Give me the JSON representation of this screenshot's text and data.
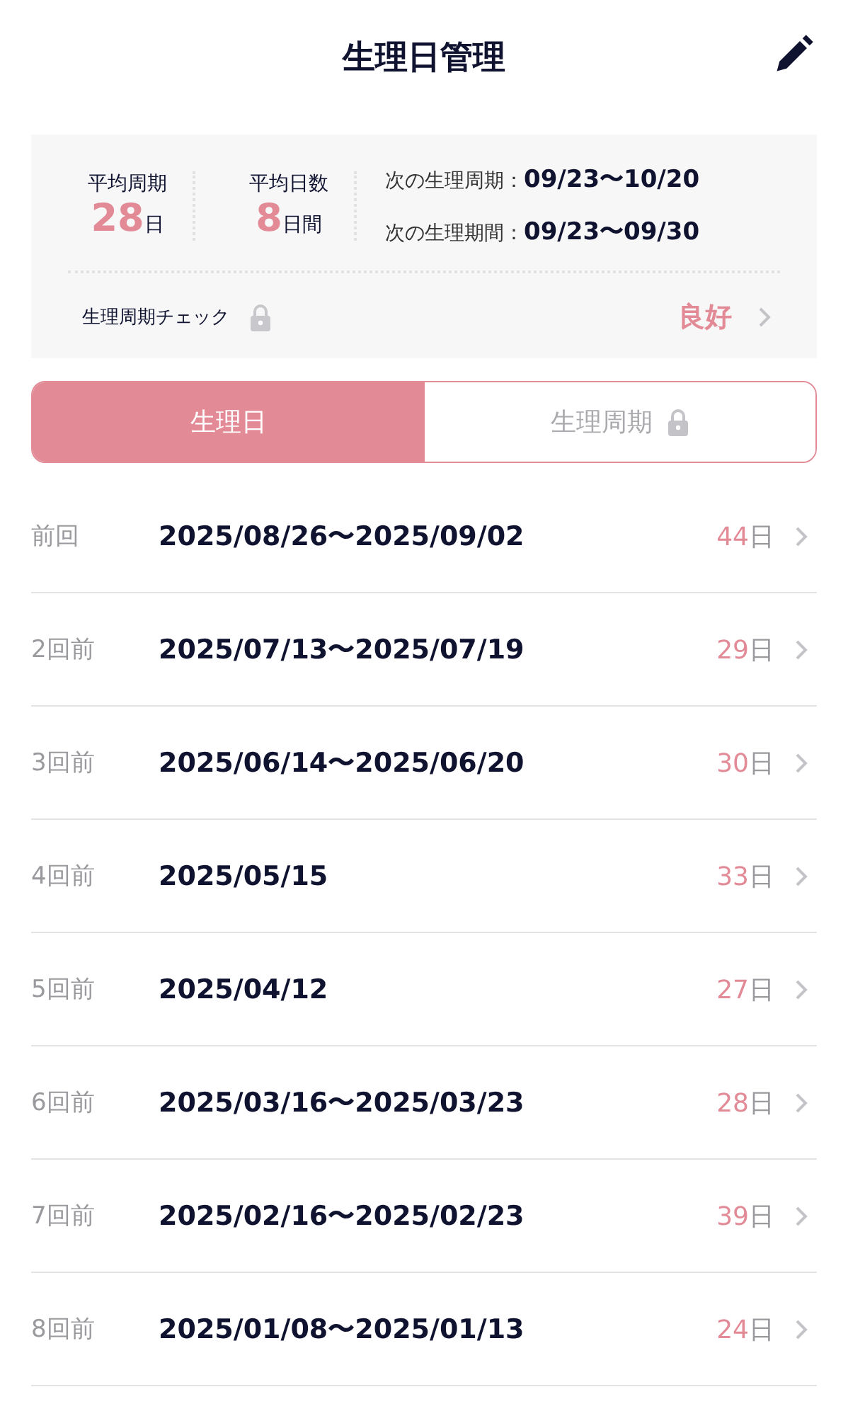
{
  "header": {
    "title": "生理日管理"
  },
  "summary": {
    "stats": [
      {
        "label": "平均周期",
        "value": "28",
        "unit": "日"
      },
      {
        "label": "平均日数",
        "value": "8",
        "unit": "日間"
      }
    ],
    "next": [
      {
        "label": "次の生理周期：",
        "value": "09/23〜10/20"
      },
      {
        "label": "次の生理期間：",
        "value": "09/23〜09/30"
      }
    ],
    "check": {
      "label": "生理周期チェック",
      "locked": true,
      "result": "良好"
    }
  },
  "tabs": [
    {
      "label": "生理日",
      "selected": true,
      "locked": false
    },
    {
      "label": "生理周期",
      "selected": false,
      "locked": true
    }
  ],
  "records": [
    {
      "label": "前回",
      "dates": "2025/08/26〜2025/09/02",
      "days": "44",
      "unit": "日"
    },
    {
      "label": "2回前",
      "dates": "2025/07/13〜2025/07/19",
      "days": "29",
      "unit": "日"
    },
    {
      "label": "3回前",
      "dates": "2025/06/14〜2025/06/20",
      "days": "30",
      "unit": "日"
    },
    {
      "label": "4回前",
      "dates": "2025/05/15",
      "days": "33",
      "unit": "日"
    },
    {
      "label": "5回前",
      "dates": "2025/04/12",
      "days": "27",
      "unit": "日"
    },
    {
      "label": "6回前",
      "dates": "2025/03/16〜2025/03/23",
      "days": "28",
      "unit": "日"
    },
    {
      "label": "7回前",
      "dates": "2025/02/16〜2025/02/23",
      "days": "39",
      "unit": "日"
    },
    {
      "label": "8回前",
      "dates": "2025/01/08〜2025/01/13",
      "days": "24",
      "unit": "日"
    }
  ]
}
